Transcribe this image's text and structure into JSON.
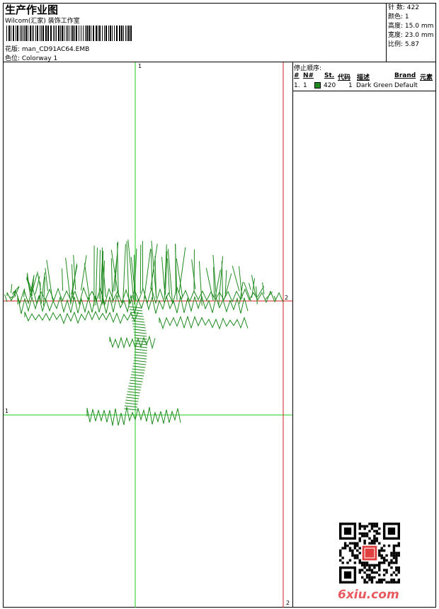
{
  "header": {
    "title": "生产作业图",
    "studio": "Wilcom(汇家) 装饰工作室",
    "design_label": "花版: man_CD91AC64.EMB",
    "colorway_label": "色位: Colorway 1"
  },
  "stats": [
    {
      "label": "针 数:",
      "value": "422"
    },
    {
      "label": "颜色:",
      "value": "1"
    },
    {
      "label": "高度:",
      "value": "15.0 mm"
    },
    {
      "label": "宽度:",
      "value": "23.0 mm"
    },
    {
      "label": "比例:",
      "value": "5.87"
    }
  ],
  "stop_sequence": {
    "title": "停止顺序:",
    "columns": {
      "idx": "#",
      "no": "N#",
      "stitches": "St.",
      "code": "代码",
      "desc": "描述",
      "brand": "Brand",
      "element": "元素"
    },
    "rows": [
      {
        "idx": "1.",
        "no": "1",
        "stitches": "420",
        "code": "1",
        "desc": "Dark Green",
        "brand": "Default",
        "color": "#1f8a1f"
      }
    ]
  },
  "guides": {
    "top_marker": "1",
    "left_marker": "1",
    "right_marker": "2",
    "bottom_marker": "2"
  },
  "watermark": {
    "text": "6xiu.com"
  },
  "colors": {
    "guide": "#22cc22",
    "guide_red": "#cc2222",
    "thread": "#1f8a1f"
  }
}
